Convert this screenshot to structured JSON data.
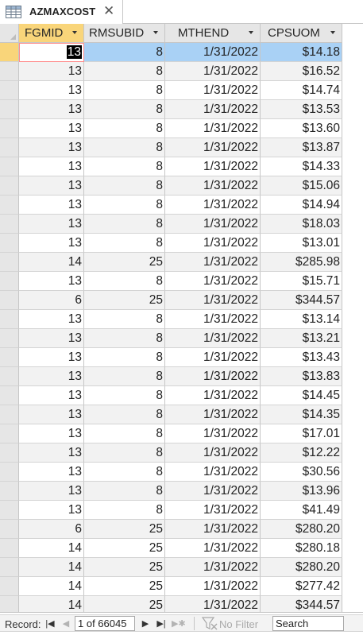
{
  "tab": {
    "title": "AZMAXCOST",
    "icon": "table-icon",
    "close_icon": "close-icon"
  },
  "columns": [
    "FGMID",
    "RMSUBID",
    "MTHEND",
    "CPSUOM"
  ],
  "rows": [
    [
      "13",
      "8",
      "1/31/2022",
      "$14.18"
    ],
    [
      "13",
      "8",
      "1/31/2022",
      "$16.52"
    ],
    [
      "13",
      "8",
      "1/31/2022",
      "$14.74"
    ],
    [
      "13",
      "8",
      "1/31/2022",
      "$13.53"
    ],
    [
      "13",
      "8",
      "1/31/2022",
      "$13.60"
    ],
    [
      "13",
      "8",
      "1/31/2022",
      "$13.87"
    ],
    [
      "13",
      "8",
      "1/31/2022",
      "$14.33"
    ],
    [
      "13",
      "8",
      "1/31/2022",
      "$15.06"
    ],
    [
      "13",
      "8",
      "1/31/2022",
      "$14.94"
    ],
    [
      "13",
      "8",
      "1/31/2022",
      "$18.03"
    ],
    [
      "13",
      "8",
      "1/31/2022",
      "$13.01"
    ],
    [
      "14",
      "25",
      "1/31/2022",
      "$285.98"
    ],
    [
      "13",
      "8",
      "1/31/2022",
      "$15.71"
    ],
    [
      "6",
      "25",
      "1/31/2022",
      "$344.57"
    ],
    [
      "13",
      "8",
      "1/31/2022",
      "$13.14"
    ],
    [
      "13",
      "8",
      "1/31/2022",
      "$13.21"
    ],
    [
      "13",
      "8",
      "1/31/2022",
      "$13.43"
    ],
    [
      "13",
      "8",
      "1/31/2022",
      "$13.83"
    ],
    [
      "13",
      "8",
      "1/31/2022",
      "$14.45"
    ],
    [
      "13",
      "8",
      "1/31/2022",
      "$14.35"
    ],
    [
      "13",
      "8",
      "1/31/2022",
      "$17.01"
    ],
    [
      "13",
      "8",
      "1/31/2022",
      "$12.22"
    ],
    [
      "13",
      "8",
      "1/31/2022",
      "$30.56"
    ],
    [
      "13",
      "8",
      "1/31/2022",
      "$13.96"
    ],
    [
      "13",
      "8",
      "1/31/2022",
      "$41.49"
    ],
    [
      "6",
      "25",
      "1/31/2022",
      "$280.20"
    ],
    [
      "14",
      "25",
      "1/31/2022",
      "$280.18"
    ],
    [
      "14",
      "25",
      "1/31/2022",
      "$280.20"
    ],
    [
      "14",
      "25",
      "1/31/2022",
      "$277.42"
    ],
    [
      "14",
      "25",
      "1/31/2022",
      "$344.57"
    ]
  ],
  "nav": {
    "record_label": "Record:",
    "position": "1 of 66045",
    "filter_label": "No Filter",
    "search_value": "Search",
    "first_icon": "first-record-icon",
    "prev_icon": "previous-record-icon",
    "next_icon": "next-record-icon",
    "last_icon": "last-record-icon",
    "new_icon": "new-record-icon",
    "filter_icon": "filter-icon"
  },
  "colors": {
    "header_bg": "#e6e6e6",
    "active_header": "#f9d57a",
    "selected_row": "#a9d1f5",
    "alt_row": "#f2f2f2"
  }
}
